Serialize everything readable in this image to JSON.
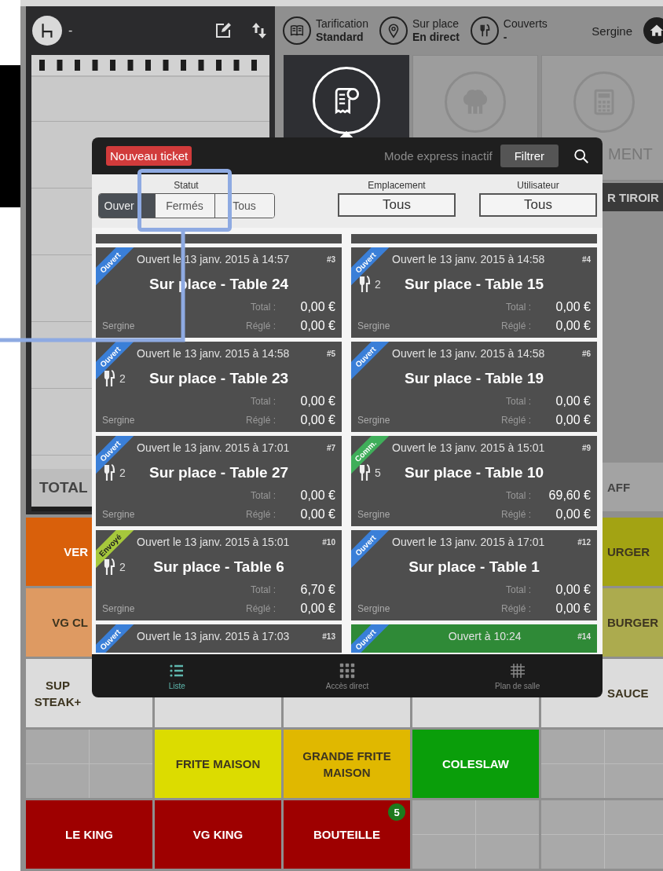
{
  "order_panel": {
    "table": "-",
    "total_label": "TOTAL"
  },
  "top_bar": {
    "items": [
      {
        "kind": "book",
        "label": "Tarification",
        "value": "Standard"
      },
      {
        "kind": "pin",
        "label": "Sur place",
        "value": "En direct"
      },
      {
        "kind": "cutlery",
        "label": "Couverts",
        "value": "-"
      }
    ],
    "user": "Sergine"
  },
  "tiles": [
    {
      "kind": "receipt",
      "selected": true
    },
    {
      "kind": "chef",
      "selected": false
    },
    {
      "kind": "calculator",
      "selected": false,
      "label": "MENT"
    }
  ],
  "drawer_button": "R TIROIR",
  "side_button": "AFF",
  "products": [
    [
      {
        "kind": "product",
        "label": "VER",
        "color": "#d9600b"
      },
      {
        "kind": "product",
        "label": "URGER",
        "color": "#a3a313"
      }
    ],
    [
      {
        "kind": "product",
        "label": "VG CL",
        "color": "#de9a62"
      },
      {
        "kind": "product",
        "label": "BURGER",
        "color": "#acab4e"
      }
    ],
    [
      {
        "kind": "product",
        "label": "SUP STEAK+",
        "color": "#dcdcdc"
      },
      {
        "kind": "product",
        "color": "#dcdcdc"
      },
      {
        "kind": "product",
        "color": "#dcdcdc"
      },
      {
        "kind": "product",
        "color": "#dcdcdc"
      },
      {
        "kind": "product",
        "label": "SAUCE",
        "color": "#dcdcdc"
      }
    ],
    [
      {
        "kind": "empty",
        "color": "#a9a9a9"
      },
      {
        "kind": "product",
        "label": "FRITE MAISON",
        "color": "#dcdc00"
      },
      {
        "kind": "product",
        "label": "GRANDE FRITE MAISON",
        "color": "#e0b800"
      },
      {
        "kind": "product",
        "label": "COLESLAW",
        "color": "#0a9e0a"
      },
      {
        "kind": "empty",
        "color": "#a9a9a9"
      }
    ],
    [
      {
        "kind": "product",
        "label": "LE KING",
        "color": "#9e0000"
      },
      {
        "kind": "product",
        "label": "VG KING",
        "color": "#9e0000"
      },
      {
        "kind": "product",
        "label": "BOUTEILLE",
        "color": "#9e0000",
        "badge": "5"
      },
      {
        "kind": "empty",
        "color": "#a9a9a9"
      },
      {
        "kind": "empty",
        "color": "#a9a9a9"
      }
    ]
  ],
  "dialog": {
    "new_ticket": "Nouveau ticket",
    "express_mode": "Mode express inactif",
    "filter_button": "Filtrer",
    "status_filter": {
      "label": "Statut",
      "options": [
        {
          "label": "Ouver",
          "selected": true
        },
        {
          "label": "Fermés",
          "selected": false
        },
        {
          "label": "Tous",
          "selected": false
        }
      ]
    },
    "location_filter": {
      "label": "Emplacement",
      "value": "Tous"
    },
    "user_filter": {
      "label": "Utilisateur",
      "value": "Tous"
    },
    "tickets": [
      {
        "kind": "full",
        "status": "Ouvert",
        "color": "#3a7fd8",
        "opened": "Ouvert le 13 janv. 2015 à 14:57",
        "number": "#3",
        "title": "Sur place - Table 24",
        "total_label": "Total :",
        "total": "0,00 €",
        "paid_label": "Réglé :",
        "paid": "0,00 €",
        "user": "Sergine",
        "highlighted": false
      },
      {
        "kind": "full",
        "status": "Ouvert",
        "color": "#3a7fd8",
        "opened": "Ouvert le 13 janv. 2015 à 14:58",
        "number": "#4",
        "covers": "2",
        "title": "Sur place - Table 15",
        "total_label": "Total :",
        "total": "0,00 €",
        "paid_label": "Réglé :",
        "paid": "0,00 €",
        "user": "Sergine",
        "highlighted": false
      },
      {
        "kind": "full",
        "status": "Ouvert",
        "color": "#3a7fd8",
        "opened": "Ouvert le 13 janv. 2015 à 14:58",
        "number": "#5",
        "covers": "2",
        "title": "Sur place - Table 23",
        "total_label": "Total :",
        "total": "0,00 €",
        "paid_label": "Réglé :",
        "paid": "0,00 €",
        "user": "Sergine",
        "highlighted": false
      },
      {
        "kind": "full",
        "status": "Ouvert",
        "color": "#3a7fd8",
        "opened": "Ouvert le 13 janv. 2015 à 14:58",
        "number": "#6",
        "title": "Sur place - Table 19",
        "total_label": "Total :",
        "total": "0,00 €",
        "paid_label": "Réglé :",
        "paid": "0,00 €",
        "user": "Sergine",
        "highlighted": false
      },
      {
        "kind": "full",
        "status": "Ouvert",
        "color": "#3a7fd8",
        "opened": "Ouvert le 13 janv. 2015 à 17:01",
        "number": "#7",
        "covers": "2",
        "title": "Sur place - Table 27",
        "total_label": "Total :",
        "total": "0,00 €",
        "paid_label": "Réglé :",
        "paid": "0,00 €",
        "user": "Sergine",
        "highlighted": false
      },
      {
        "kind": "full",
        "status": "Comm.",
        "color": "#3fae5a",
        "opened": "Ouvert le 13 janv. 2015 à 15:01",
        "number": "#9",
        "covers": "5",
        "title": "Sur place - Table 10",
        "total_label": "Total :",
        "total": "69,60 €",
        "paid_label": "Réglé :",
        "paid": "0,00 €",
        "user": "Sergine",
        "highlighted": false
      },
      {
        "kind": "full",
        "status": "Envoyé",
        "color": "#a6c83c",
        "opened": "Ouvert le 13 janv. 2015 à 15:01",
        "number": "#10",
        "covers": "2",
        "title": "Sur place - Table 6",
        "total_label": "Total :",
        "total": "6,70 €",
        "paid_label": "Réglé :",
        "paid": "0,00 €",
        "user": "Sergine",
        "highlighted": false
      },
      {
        "kind": "full",
        "status": "Ouvert",
        "color": "#3a7fd8",
        "opened": "Ouvert le 13 janv. 2015 à 17:01",
        "number": "#12",
        "title": "Sur place - Table 1",
        "total_label": "Total :",
        "total": "0,00 €",
        "paid_label": "Réglé :",
        "paid": "0,00 €",
        "user": "Sergine",
        "highlighted": false
      },
      {
        "kind": "partial",
        "status": "Ouvert",
        "color": "#3a7fd8",
        "opened": "Ouvert le 13 janv. 2015 à 17:03",
        "number": "#13",
        "highlighted": false
      },
      {
        "kind": "partial",
        "status": "Ouvert",
        "color": "#3a7fd8",
        "opened": "Ouvert à 10:24",
        "number": "#14",
        "highlighted": true
      }
    ],
    "nav": [
      {
        "kind": "list",
        "label": "Liste",
        "selected": true
      },
      {
        "kind": "dots",
        "label": "Accès direct",
        "selected": false
      },
      {
        "kind": "grid",
        "label": "Plan de salle",
        "selected": false
      }
    ]
  }
}
